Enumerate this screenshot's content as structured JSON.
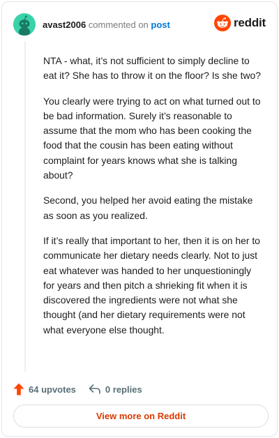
{
  "header": {
    "username": "avast2006",
    "verb": " commented on ",
    "post_link": "post",
    "brand": "reddit"
  },
  "comment": {
    "paragraphs": [
      "NTA - what, it’s not sufficient to simply decline to eat it? She has to throw it on the floor? Is she two?",
      "You clearly were trying to act on what turned out to be bad information. Surely it’s reasonable to assume that the mom who has been cooking the food that the cousin has been eating without complaint for years knows what she is talking about?",
      "Second, you helped her avoid eating the mistake as soon as you realized.",
      "If it’s really that important to her, then it is on her to communicate her dietary needs clearly. Not to just eat whatever was handed to her unquestioningly for years and then pitch a shrieking fit when it is discovered the ingredients were not what she thought (and her dietary requirements were not what everyone else thought."
    ]
  },
  "actions": {
    "upvotes": "64 upvotes",
    "replies": "0 replies"
  },
  "footer": {
    "view_more": "View more on Reddit"
  },
  "colors": {
    "upvote": "#ff4500",
    "link": "#0079d3",
    "cta": "#d93a00",
    "avatar_bg": "#3ad2a9"
  }
}
